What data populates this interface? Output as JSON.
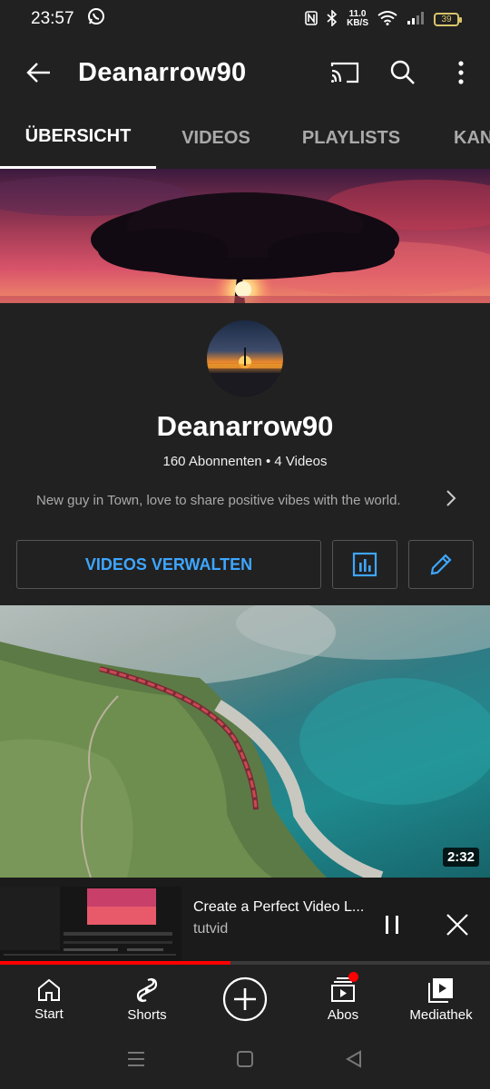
{
  "status_bar": {
    "time": "23:57",
    "net_speed_value": "11.0",
    "net_speed_unit": "KB/S",
    "battery": "39"
  },
  "app_bar": {
    "title": "Deanarrow90"
  },
  "tabs": [
    {
      "label": "ÜBERSICHT",
      "active": true
    },
    {
      "label": "VIDEOS",
      "active": false
    },
    {
      "label": "PLAYLISTS",
      "active": false
    },
    {
      "label": "KAN",
      "active": false
    }
  ],
  "channel": {
    "name": "Deanarrow90",
    "subscribers": "160 Abonnenten",
    "separator": "•",
    "videos_count": "4 Videos",
    "description": "New guy in Town, love to share positive vibes with the world."
  },
  "actions": {
    "manage_videos_label": "VIDEOS VERWALTEN"
  },
  "featured_video": {
    "duration": "2:32"
  },
  "mini_player": {
    "title": "Create a Perfect Video L...",
    "channel": "tutvid",
    "progress": 0.47
  },
  "bottom_nav": [
    {
      "label": "Start",
      "icon": "home-icon"
    },
    {
      "label": "Shorts",
      "icon": "shorts-icon"
    },
    {
      "label": "",
      "icon": "create-icon"
    },
    {
      "label": "Abos",
      "icon": "subscriptions-icon",
      "badge": true
    },
    {
      "label": "Mediathek",
      "icon": "library-icon"
    }
  ],
  "colors": {
    "accent_blue": "#3ea6ff",
    "background": "#212121",
    "progress_red": "#ff0000"
  }
}
